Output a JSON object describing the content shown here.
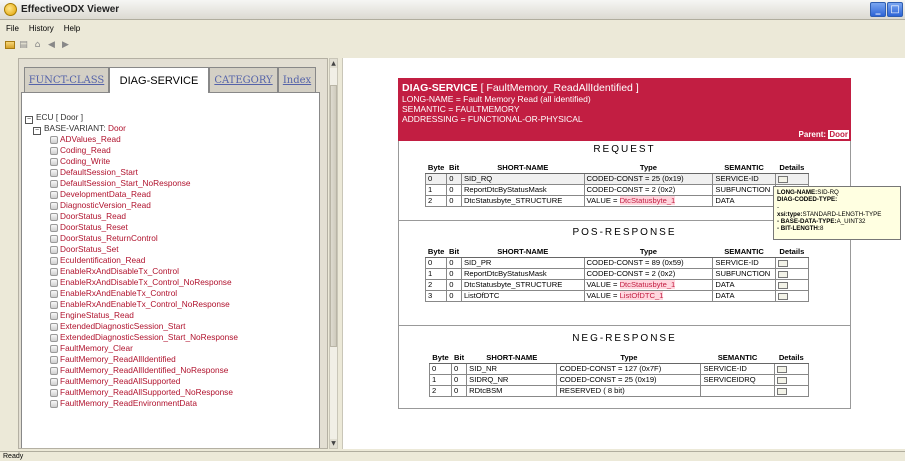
{
  "window": {
    "title": "EffectiveODX Viewer"
  },
  "menu": [
    "File",
    "History",
    "Help"
  ],
  "tabs": [
    "FUNCT-CLASS",
    "DIAG-SERVICE",
    "CATEGORY",
    "Index"
  ],
  "tree": {
    "ecu": "ECU [ Door ]",
    "base_variant_label": "BASE-VARIANT:",
    "base_variant_name": "Door",
    "services": [
      "ADValues_Read",
      "Coding_Read",
      "Coding_Write",
      "DefaultSession_Start",
      "DefaultSession_Start_NoResponse",
      "DevelopmentData_Read",
      "DiagnosticVersion_Read",
      "DoorStatus_Read",
      "DoorStatus_Reset",
      "DoorStatus_ReturnControl",
      "DoorStatus_Set",
      "EcuIdentification_Read",
      "EnableRxAndDisableTx_Control",
      "EnableRxAndDisableTx_Control_NoResponse",
      "EnableRxAndEnableTx_Control",
      "EnableRxAndEnableTx_Control_NoResponse",
      "EngineStatus_Read",
      "ExtendedDiagnosticSession_Start",
      "ExtendedDiagnosticSession_Start_NoResponse",
      "FaultMemory_Clear",
      "FaultMemory_ReadAllIdentified",
      "FaultMemory_ReadAllIdentified_NoResponse",
      "FaultMemory_ReadAllSupported",
      "FaultMemory_ReadAllSupported_NoResponse",
      "FaultMemory_ReadEnvironmentData"
    ]
  },
  "header": {
    "prefix": "DIAG-SERVICE",
    "name": "[ FaultMemory_ReadAllIdentified ]",
    "long_name": "LONG-NAME = Fault Memory Read (all identified)",
    "semantic": "SEMANTIC = FAULTMEMORY",
    "addressing": "ADDRESSING = FUNCTIONAL-OR-PHYSICAL",
    "parent_label": "Parent:",
    "parent_value": "Door"
  },
  "columns": [
    "Byte",
    "Bit",
    "SHORT-NAME",
    "Type",
    "SEMANTIC",
    "Details"
  ],
  "request": {
    "title": "REQUEST",
    "rows": [
      {
        "byte": "0",
        "bit": "0",
        "short_name": "SID_RQ",
        "type_prefix": "CODED-CONST = 25 (0x19)",
        "type_ref": "",
        "semantic": "SERVICE-ID"
      },
      {
        "byte": "1",
        "bit": "0",
        "short_name": "ReportDtcByStatusMask",
        "type_prefix": "CODED-CONST = 2 (0x2)",
        "type_ref": "",
        "semantic": "SUBFUNCTION"
      },
      {
        "byte": "2",
        "bit": "0",
        "short_name": "DtcStatusbyte_STRUCTURE",
        "type_prefix": "VALUE =",
        "type_ref": "DtcStatusbyte_1",
        "semantic": "DATA"
      }
    ]
  },
  "pos_response": {
    "title": "POS-RESPONSE",
    "rows": [
      {
        "byte": "0",
        "bit": "0",
        "short_name": "SID_PR",
        "type_prefix": "CODED-CONST = 89 (0x59)",
        "type_ref": "",
        "semantic": "SERVICE-ID"
      },
      {
        "byte": "1",
        "bit": "0",
        "short_name": "ReportDtcByStatusMask",
        "type_prefix": "CODED-CONST = 2 (0x2)",
        "type_ref": "",
        "semantic": "SUBFUNCTION"
      },
      {
        "byte": "2",
        "bit": "0",
        "short_name": "DtcStatusbyte_STRUCTURE",
        "type_prefix": "VALUE =",
        "type_ref": "DtcStatusbyte_1",
        "semantic": "DATA"
      },
      {
        "byte": "3",
        "bit": "0",
        "short_name": "ListOfDTC",
        "type_prefix": "VALUE =",
        "type_ref": "ListOfDTC_1",
        "semantic": "DATA"
      }
    ]
  },
  "neg_response": {
    "title": "NEG-RESPONSE",
    "rows": [
      {
        "byte": "0",
        "bit": "0",
        "short_name": "SID_NR",
        "type_prefix": "CODED-CONST = 127 (0x7F)",
        "type_ref": "",
        "semantic": "SERVICE-ID"
      },
      {
        "byte": "1",
        "bit": "0",
        "short_name": "SIDRQ_NR",
        "type_prefix": "CODED-CONST = 25 (0x19)",
        "type_ref": "",
        "semantic": "SERVICEIDRQ"
      },
      {
        "byte": "2",
        "bit": "0",
        "short_name": "RDtcBSM",
        "type_prefix": "RESERVED ( 8 bit)",
        "type_ref": "",
        "semantic": ""
      }
    ]
  },
  "tooltip": {
    "long_name_label": "LONG-NAME:",
    "long_name_value": "SID-RQ",
    "diag_coded_type_label": "DIAG-CODED-TYPE:",
    "dash": "-",
    "xsi_type_label": "xsi:type:",
    "xsi_type_value": "STANDARD-LENGTH-TYPE",
    "base_data_type_label": "- BASE-DATA-TYPE:",
    "base_data_type_value": "A_UINT32",
    "bit_length_label": "- BIT-LENGTH:",
    "bit_length_value": "8"
  },
  "status": "Ready"
}
